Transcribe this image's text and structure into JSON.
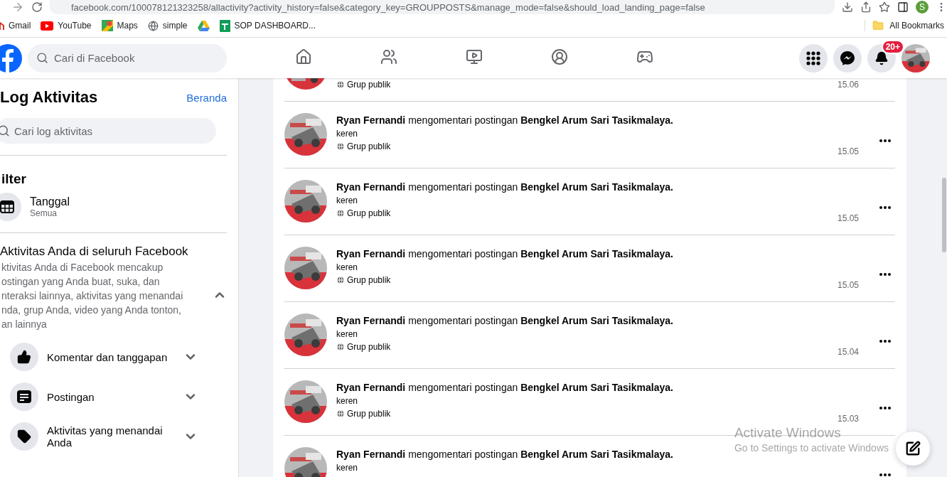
{
  "browser": {
    "url": "facebook.com/100078121323258/allactivity?activity_history=false&category_key=GROUPPOSTS&manage_mode=false&should_load_landing_page=false",
    "profile_initial": "S",
    "bookmarks": [
      {
        "kind": "gmail",
        "label": "Gmail"
      },
      {
        "kind": "youtube",
        "label": "YouTube"
      },
      {
        "kind": "maps",
        "label": "Maps"
      },
      {
        "kind": "globe",
        "label": "simple"
      },
      {
        "kind": "drive"
      },
      {
        "kind": "sheets",
        "label": "SOP DASHBOARD..."
      }
    ],
    "all_bookmarks": "All Bookmarks"
  },
  "header": {
    "search_placeholder": "Cari di Facebook",
    "nav": [
      {
        "kind": "home",
        "selected": false
      },
      {
        "kind": "friends",
        "selected": false
      },
      {
        "kind": "video",
        "selected": false
      },
      {
        "kind": "groups",
        "selected": false
      },
      {
        "kind": "gaming",
        "selected": false
      }
    ],
    "notification_badge": "20+"
  },
  "sidebar": {
    "title": "Log Aktivitas",
    "home_link": "Beranda",
    "search_placeholder": "Cari log aktivitas",
    "filter_heading": "ilter",
    "filters": [
      {
        "label": "Tanggal",
        "value": "Semua"
      }
    ],
    "section": {
      "title": "Aktivitas Anda di seluruh Facebook",
      "expanded": true,
      "description_lines": [
        "ktivitas Anda di Facebook mencakup",
        "ostingan yang Anda buat, suka, dan",
        "nteraksi lainnya, aktivitas yang menandai",
        "nda, grup Anda, video yang Anda tonton,",
        "an lainnya"
      ]
    },
    "categories": [
      {
        "kind": "like",
        "label": "Komentar dan tanggapan",
        "expanded": false
      },
      {
        "kind": "post",
        "label": "Postingan",
        "expanded": false
      },
      {
        "kind": "tag",
        "label": "Aktivitas yang menandai Anda",
        "expanded": false
      }
    ]
  },
  "feed": {
    "rows": [
      {
        "kind": "partial",
        "privacy": "Grup publik",
        "time": "15.06"
      },
      {
        "kind": "full",
        "actor": "Ryan Fernandi",
        "action": "mengomentari postingan",
        "target": "Bengkel Arum Sari Tasikmalaya.",
        "comment": "keren",
        "privacy": "Grup publik",
        "time": "15.05"
      },
      {
        "kind": "full",
        "actor": "Ryan Fernandi",
        "action": "mengomentari postingan",
        "target": "Bengkel Arum Sari Tasikmalaya.",
        "comment": "keren",
        "privacy": "Grup publik",
        "time": "15.05"
      },
      {
        "kind": "full",
        "actor": "Ryan Fernandi",
        "action": "mengomentari postingan",
        "target": "Bengkel Arum Sari Tasikmalaya.",
        "comment": "keren",
        "privacy": "Grup publik",
        "time": "15.05"
      },
      {
        "kind": "full",
        "actor": "Ryan Fernandi",
        "action": "mengomentari postingan",
        "target": "Bengkel Arum Sari Tasikmalaya.",
        "comment": "keren",
        "privacy": "Grup publik",
        "time": "15.04"
      },
      {
        "kind": "full",
        "actor": "Ryan Fernandi",
        "action": "mengomentari postingan",
        "target": "Bengkel Arum Sari Tasikmalaya.",
        "comment": "keren",
        "privacy": "Grup publik",
        "time": "15.03"
      },
      {
        "kind": "full",
        "actor": "Ryan Fernandi",
        "action": "mengomentari postingan",
        "target": "Bengkel Arum Sari Tasikmalaya.",
        "comment": "keren"
      }
    ]
  },
  "os_notice": {
    "title": "Activate Windows",
    "subtitle": "Go to Settings to activate Windows"
  }
}
